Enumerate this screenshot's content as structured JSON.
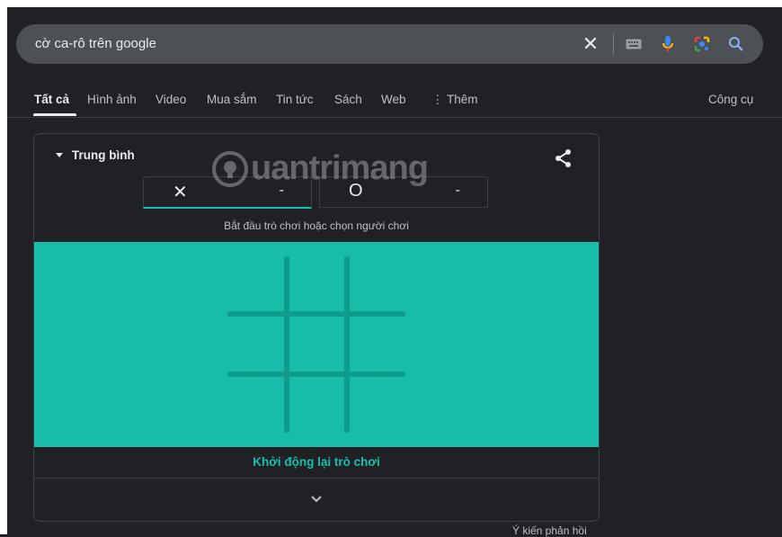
{
  "search": {
    "query": "cờ ca-rô trên google",
    "icons": [
      "close-icon",
      "keyboard-icon",
      "microphone-icon",
      "google-lens-icon",
      "search-icon"
    ]
  },
  "tabs": {
    "items": [
      {
        "label": "Tất cả",
        "active": true
      },
      {
        "label": "Hình ảnh"
      },
      {
        "label": "Video"
      },
      {
        "label": "Mua sắm"
      },
      {
        "label": "Tin tức"
      },
      {
        "label": "Sách"
      },
      {
        "label": "Web"
      },
      {
        "label": "⋮ Thêm"
      }
    ],
    "tools": "Công cụ"
  },
  "game": {
    "difficulty": "Trung bình",
    "player_x": {
      "mark": "✕",
      "score": "-"
    },
    "player_o": {
      "mark": "O",
      "score": "-"
    },
    "hint": "Bắt đầu trò chơi hoặc chọn người chơi",
    "restart": "Khởi động lại trò chơi",
    "board_color": "#17bdaa",
    "accent": "#19c0b0"
  },
  "feedback": "Ý kiến phản hồi",
  "watermark": "uantrimang"
}
